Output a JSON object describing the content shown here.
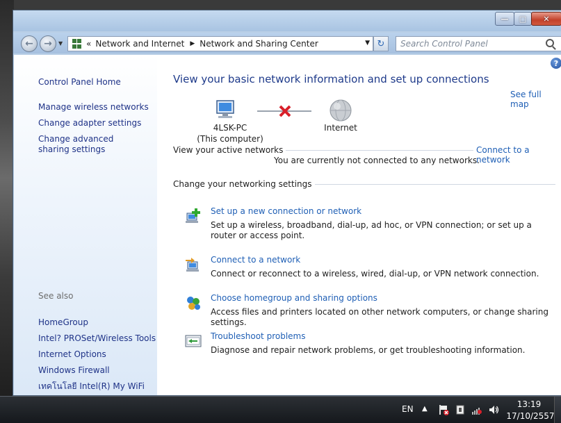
{
  "address_bar": {
    "overflow": "«",
    "crumbs": [
      "Network and Internet",
      "Network and Sharing Center"
    ]
  },
  "search": {
    "placeholder": "Search Control Panel"
  },
  "sidebar": {
    "home": "Control Panel Home",
    "links": [
      "Manage wireless networks",
      "Change adapter settings",
      "Change advanced sharing settings"
    ],
    "see_also_heading": "See also",
    "see_also": [
      "HomeGroup",
      "Intel? PROSet/Wireless Tools",
      "Internet Options",
      "Windows Firewall",
      "เทคโนโลยี Intel(R) My WiFi"
    ]
  },
  "main": {
    "title": "View your basic network information and set up connections",
    "see_full_map": "See full map",
    "map": {
      "computer_name": "4LSK-PC",
      "computer_sub": "(This computer)",
      "internet": "Internet",
      "status": "disconnected"
    },
    "active_networks_label": "View your active networks",
    "connect_link": "Connect to a network",
    "not_connected_msg": "You are currently not connected to any networks.",
    "change_settings_label": "Change your networking settings",
    "tasks": [
      {
        "link": "Set up a new connection or network",
        "desc": "Set up a wireless, broadband, dial-up, ad hoc, or VPN connection; or set up a router or access point.",
        "icon": "new-connection-icon"
      },
      {
        "link": "Connect to a network",
        "desc": "Connect or reconnect to a wireless, wired, dial-up, or VPN network connection.",
        "icon": "connect-network-icon"
      },
      {
        "link": "Choose homegroup and sharing options",
        "desc": "Access files and printers located on other network computers, or change sharing settings.",
        "icon": "homegroup-icon"
      },
      {
        "link": "Troubleshoot problems",
        "desc": "Diagnose and repair network problems, or get troubleshooting information.",
        "icon": "troubleshoot-icon"
      }
    ]
  },
  "taskbar": {
    "language": "EN",
    "time": "13:19",
    "date": "17/10/2557"
  },
  "colors": {
    "link": "#1f5fb5",
    "title": "#1e3a8a",
    "sidebar_link": "#1e3287",
    "error_x": "#d8202a"
  }
}
